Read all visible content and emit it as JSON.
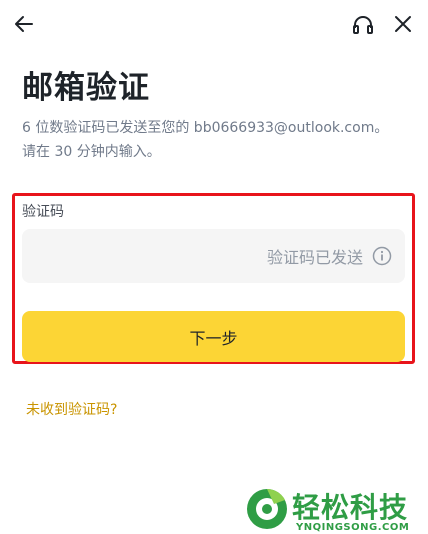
{
  "header": {
    "back_icon": "arrow-left-icon",
    "support_icon": "headset-icon",
    "close_icon": "close-icon"
  },
  "page": {
    "title": "邮箱验证",
    "description_line1": "6 位数验证码已发送至您的 bb0666933@outlook.com。",
    "description_line2": "请在 30 分钟内输入。"
  },
  "form": {
    "code_label": "验证码",
    "code_status": "验证码已发送",
    "info_icon": "info-circle-icon",
    "next_button": "下一步"
  },
  "links": {
    "not_received": "未收到验证码?"
  },
  "watermark": {
    "text": "轻松科技",
    "subtext": "YNQINGSONG.COM"
  },
  "colors": {
    "accent": "#fcd535",
    "link": "#c99400",
    "highlight_box": "#e8141b",
    "watermark": "#2f9d45"
  }
}
